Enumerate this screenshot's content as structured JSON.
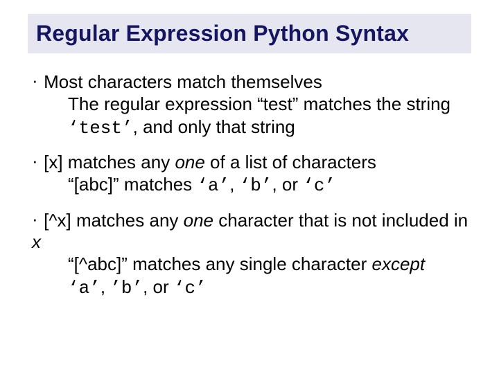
{
  "title": "Regular Expression Python Syntax",
  "bullets": {
    "b1": {
      "head": "Most characters match themselves",
      "sub_pre": "The regular expression “test” matches the string ",
      "sub_code": "‘test’",
      "sub_post": ", and only that string"
    },
    "b2": {
      "head_pre": "[x] matches any ",
      "head_em": "one",
      "head_post": " of a list of characters",
      "sub_pre": "“[abc]” matches ",
      "sub_a": "‘a’",
      "sub_c1": ", ",
      "sub_b": "‘b’",
      "sub_c2": ", or ",
      "sub_c": "‘c’"
    },
    "b3": {
      "head_pre": "[^x] matches any ",
      "head_em": "one",
      "head_post1": " character that is not included in ",
      "head_x": "x",
      "sub_pre": "“[^abc]” matches any single character ",
      "sub_em": "except",
      "sub_br": " ",
      "sub_a": "‘a’",
      "sub_c1": ", ",
      "sub_b": "’b’",
      "sub_c2": ", or ",
      "sub_c": "‘c’"
    }
  }
}
